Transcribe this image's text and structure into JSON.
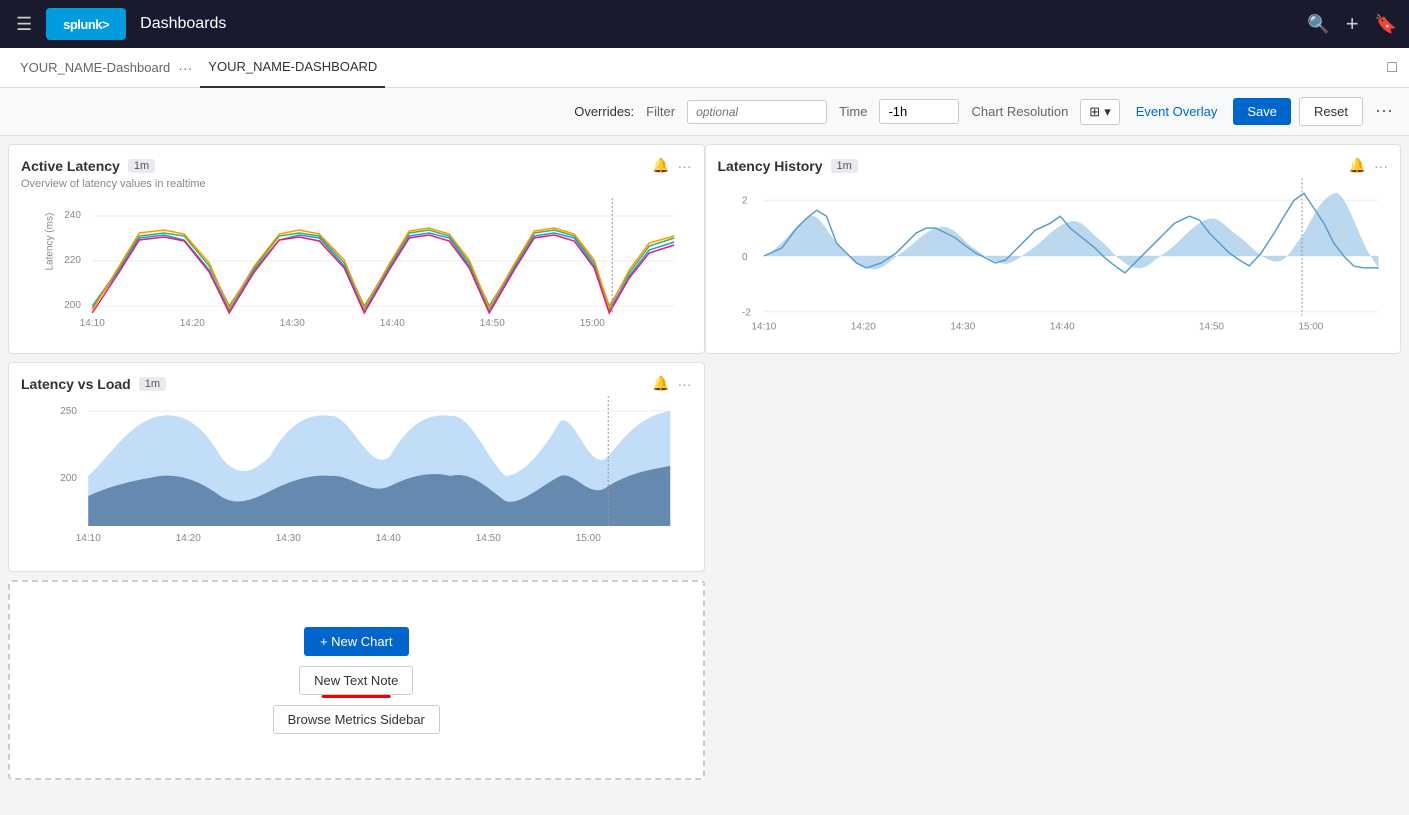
{
  "topbar": {
    "menu_icon": "☰",
    "logo_text": "splunk>",
    "app_title": "Dashboards",
    "search_icon": "🔍",
    "add_icon": "+",
    "bookmark_icon": "🔖"
  },
  "tabs": {
    "inactive_tab": "YOUR_NAME-Dashboard",
    "active_tab": "YOUR_NAME-DASHBOARD",
    "more_icon": "···",
    "sidebar_icon": "▣"
  },
  "toolbar": {
    "overrides_label": "Overrides:",
    "filter_label": "Filter",
    "filter_placeholder": "optional",
    "time_label": "Time",
    "time_value": "-1h",
    "chart_res_label": "Chart Resolution",
    "event_overlay_label": "Event Overlay",
    "save_label": "Save",
    "reset_label": "Reset",
    "more_icon": "⋯"
  },
  "panels": {
    "active_latency": {
      "title": "Active Latency",
      "badge": "1m",
      "subtitle": "Overview of latency values in realtime",
      "y_label": "Latency (ms)",
      "y_ticks": [
        "240",
        "220",
        "200"
      ],
      "x_ticks": [
        "14:10",
        "14:20",
        "14:30",
        "14:40",
        "14:50",
        "15:00"
      ]
    },
    "latency_vs_load": {
      "title": "Latency vs Load",
      "badge": "1m",
      "y_ticks": [
        "250",
        "200"
      ],
      "x_ticks": [
        "14:10",
        "14:20",
        "14:30",
        "14:40",
        "14:50",
        "15:00"
      ]
    },
    "latency_history": {
      "title": "Latency History",
      "badge": "1m",
      "y_ticks": [
        "2",
        "0",
        "-2"
      ],
      "x_ticks": [
        "14:10",
        "14:20",
        "14:30",
        "14:40",
        "14:50",
        "15:00"
      ]
    },
    "add_panel": {
      "new_chart_label": "+ New Chart",
      "new_text_label": "New Text Note",
      "browse_metrics_label": "Browse Metrics Sidebar"
    }
  }
}
